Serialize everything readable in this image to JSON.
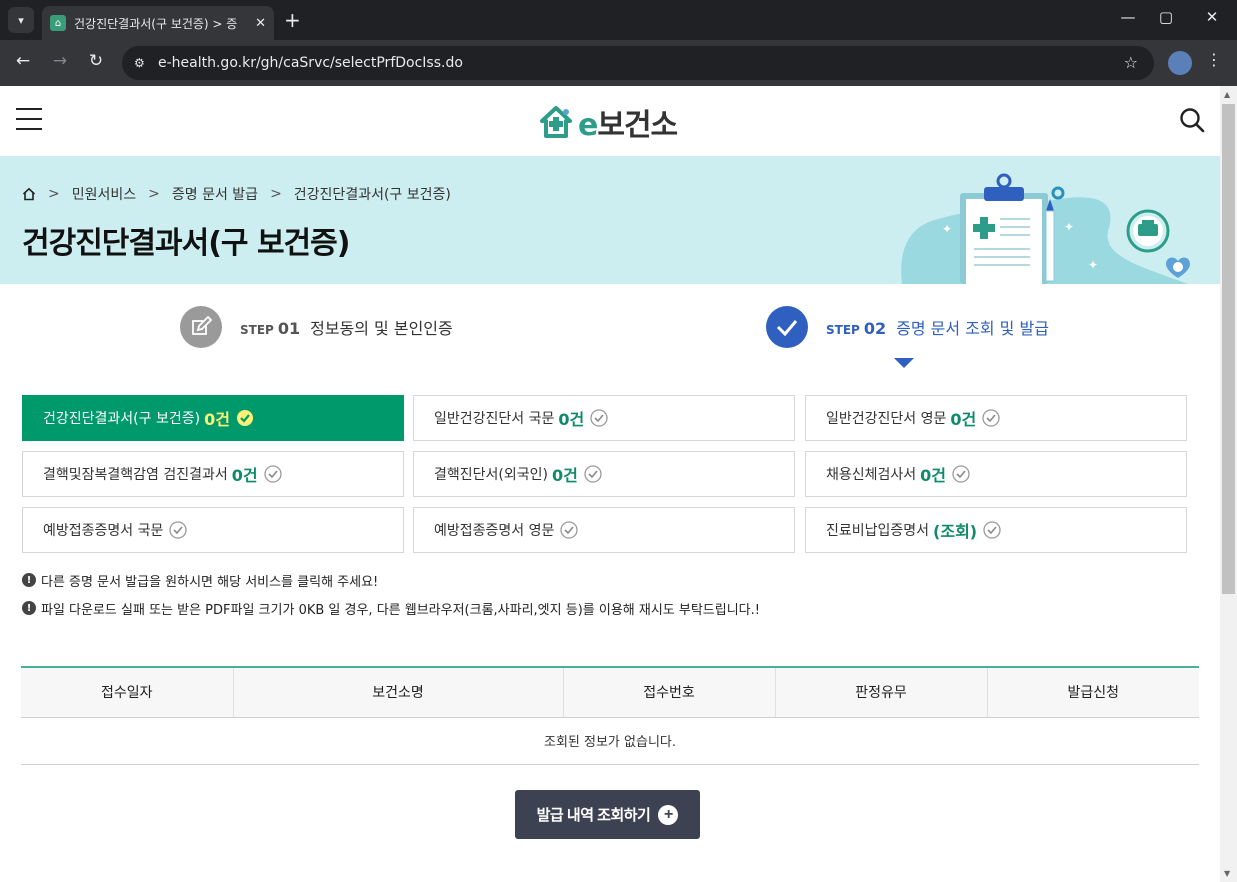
{
  "browser": {
    "tab_title": "건강진단결과서(구 보건증) > 증",
    "tab_close": "✕",
    "new_tab": "+",
    "url": "e-health.go.kr/gh/caSrvc/selectPrfDocIss.do"
  },
  "header": {
    "logo_e": "e",
    "logo_text": "보건소"
  },
  "breadcrumb": {
    "items": [
      "민원서비스",
      "증명 문서 발급",
      "건강진단결과서(구 보건증)"
    ],
    "sep": ">"
  },
  "page_title": "건강진단결과서(구 보건증)",
  "steps": [
    {
      "word": "STEP",
      "num": "01",
      "text": "정보동의 및 본인인증"
    },
    {
      "word": "STEP",
      "num": "02",
      "text": "증명 문서 조회 및 발급"
    }
  ],
  "cards": [
    {
      "label": "건강진단결과서(구 보건증)",
      "count": "0건",
      "active": true
    },
    {
      "label": "일반건강진단서 국문",
      "count": "0건"
    },
    {
      "label": "일반건강진단서 영문",
      "count": "0건"
    },
    {
      "label": "결핵및잠복결핵감염 검진결과서",
      "count": "0건"
    },
    {
      "label": "결핵진단서(외국인)",
      "count": "0건"
    },
    {
      "label": "채용신체검사서",
      "count": "0건"
    },
    {
      "label": "예방접종증명서 국문",
      "count": ""
    },
    {
      "label": "예방접종증명서 영문",
      "count": ""
    },
    {
      "label": "진료비납입증명서",
      "count": "(조회)"
    }
  ],
  "notes": [
    "다른 증명 문서 발급을 원하시면 해당 서비스를 클릭해 주세요!",
    "파일 다운로드 실패 또는 받은 PDF파일 크기가 0KB 일 경우, 다른 웹브라우저(크롬,사파리,엣지 등)를 이용해 재시도 부탁드립니다.!"
  ],
  "note_icon": "!",
  "table": {
    "headers": [
      "접수일자",
      "보건소명",
      "접수번호",
      "판정유무",
      "발급신청"
    ],
    "empty_text": "조회된 정보가 없습니다."
  },
  "history_button": {
    "label": "발급 내역 조회하기",
    "icon": "+"
  },
  "colors": {
    "accent_green": "#00996b",
    "step_blue": "#2f5fbf",
    "banner_bg": "#cdeef0",
    "button_dark": "#3d4253"
  }
}
